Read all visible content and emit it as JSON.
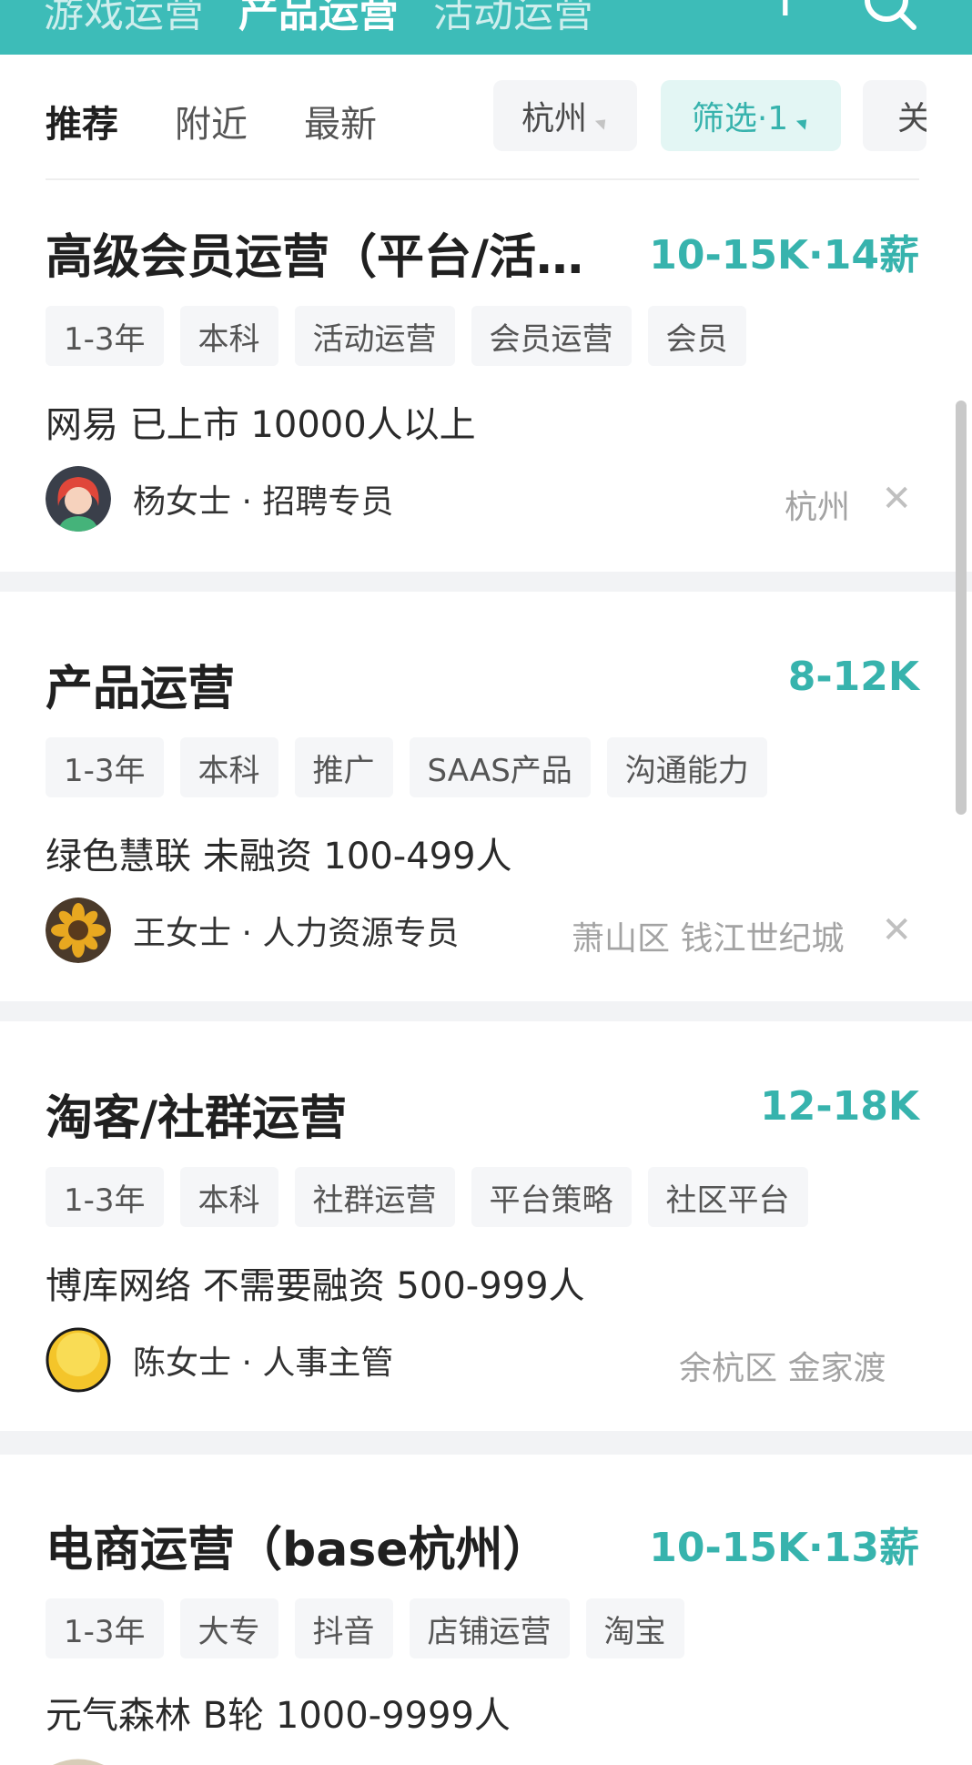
{
  "top_nav": {
    "tabs": [
      {
        "label": "游戏运营",
        "active": false
      },
      {
        "label": "产品运营",
        "active": true
      },
      {
        "label": "活动运营",
        "active": false
      }
    ],
    "add_icon": "plus-icon",
    "search_icon": "search-icon",
    "color": "#3dbcb8"
  },
  "filter_bar": {
    "tabs": [
      {
        "label": "推荐",
        "active": true
      },
      {
        "label": "附近",
        "active": false
      },
      {
        "label": "最新",
        "active": false
      }
    ],
    "city": "杭州",
    "filter": "筛选·1",
    "more_partial": "关"
  },
  "jobs": [
    {
      "title": "高级会员运营（平台/活…",
      "salary": "10-15K·14薪",
      "tags": [
        "1-3年",
        "本科",
        "活动运营",
        "会员运营",
        "会员"
      ],
      "company": "网易 已上市 10000人以上",
      "recruiter": "杨女士 · 招聘专员",
      "location": "杭州",
      "dismissible": true
    },
    {
      "title": "产品运营",
      "salary": "8-12K",
      "tags": [
        "1-3年",
        "本科",
        "推广",
        "SAAS产品",
        "沟通能力"
      ],
      "company": "绿色慧联 未融资 100-499人",
      "recruiter": "王女士 · 人力资源专员",
      "location": "萧山区 钱江世纪城",
      "dismissible": true
    },
    {
      "title": "淘客/社群运营",
      "salary": "12-18K",
      "tags": [
        "1-3年",
        "本科",
        "社群运营",
        "平台策略",
        "社区平台"
      ],
      "company": "博库网络 不需要融资 500-999人",
      "recruiter": "陈女士 · 人事主管",
      "location": "余杭区 金家渡",
      "dismissible": false
    },
    {
      "title": "电商运营（base杭州）",
      "salary": "10-15K·13薪",
      "tags": [
        "1-3年",
        "大专",
        "抖音",
        "店铺运营",
        "淘宝"
      ],
      "company": "元气森林 B轮 1000-9999人"
    }
  ],
  "accent_color": "#37b3ad"
}
